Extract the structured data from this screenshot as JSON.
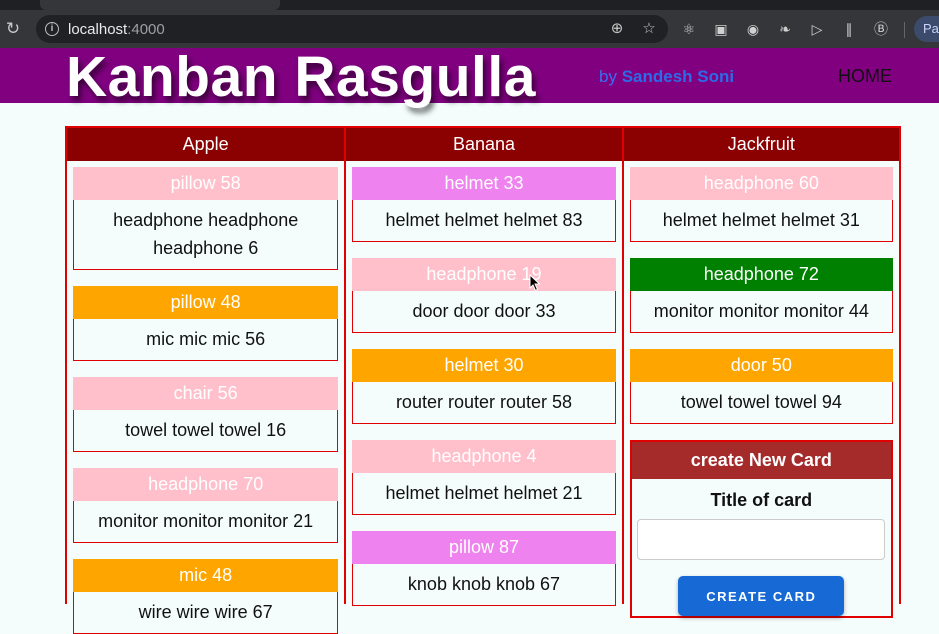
{
  "browser": {
    "url_host": "localhost",
    "url_port": ":4000",
    "profile_label": "Pa",
    "extensions": [
      "zoom-icon",
      "star-icon",
      "react-icon",
      "extension-icon",
      "account-icon",
      "ghost-icon",
      "play-icon",
      "lines-icon",
      "b-icon"
    ]
  },
  "header": {
    "title": "Kanban Rasgulla",
    "by": "by",
    "author": "Sandesh Soni",
    "home": "HOME"
  },
  "colors": {
    "pink": "#ffc0cb",
    "violet": "#ee82ee",
    "orange": "#ffa500",
    "green": "#008000"
  },
  "columns": [
    {
      "title": "Apple",
      "cards": [
        {
          "title": "pillow 58",
          "body": "headphone headphone headphone 6",
          "color": "#ffc0cb"
        },
        {
          "title": "pillow 48",
          "body": "mic mic mic 56",
          "color": "#ffa500"
        },
        {
          "title": "chair 56",
          "body": "towel towel towel 16",
          "color": "#ffc0cb"
        },
        {
          "title": "headphone 70",
          "body": "monitor monitor monitor 21",
          "color": "#ffc0cb"
        },
        {
          "title": "mic 48",
          "body": "wire wire wire 67",
          "color": "#ffa500"
        }
      ]
    },
    {
      "title": "Banana",
      "cards": [
        {
          "title": "helmet 33",
          "body": "helmet helmet helmet 83",
          "color": "#ee82ee"
        },
        {
          "title": "headphone 19",
          "body": "door door door 33",
          "color": "#ffc0cb"
        },
        {
          "title": "helmet 30",
          "body": "router router router 58",
          "color": "#ffa500"
        },
        {
          "title": "headphone 4",
          "body": "helmet helmet helmet 21",
          "color": "#ffc0cb"
        },
        {
          "title": "pillow 87",
          "body": "knob knob knob 67",
          "color": "#ee82ee"
        }
      ]
    },
    {
      "title": "Jackfruit",
      "cards": [
        {
          "title": "headphone 60",
          "body": "helmet helmet helmet 31",
          "color": "#ffc0cb"
        },
        {
          "title": "headphone 72",
          "body": "monitor monitor monitor 44",
          "color": "#008000"
        },
        {
          "title": "door 50",
          "body": "towel towel towel 94",
          "color": "#ffa500"
        }
      ]
    }
  ],
  "create": {
    "heading": "create New Card",
    "label": "Title of card",
    "input_value": "",
    "button": "CREATE CARD"
  }
}
